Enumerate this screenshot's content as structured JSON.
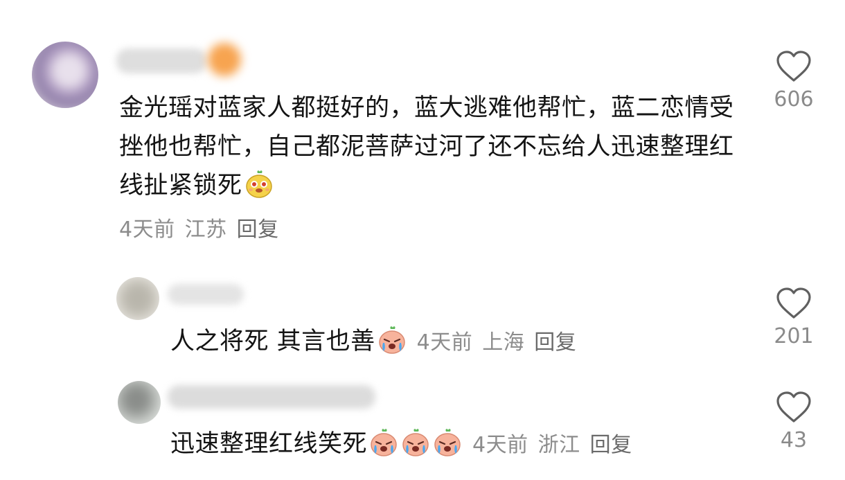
{
  "comments": [
    {
      "text": "金光瑶对蓝家人都挺好的，蓝大逃难他帮忙，蓝二恋情受挫他也帮忙，自己都泥菩萨过河了还不忘给人迅速整理红线扯紧锁死",
      "emoji": "smiling-face-emoji",
      "time": "4天前",
      "location": "江苏",
      "reply_label": "回复",
      "likes": "606"
    },
    {
      "text": "人之将死 其言也善",
      "emoji": "crying-face-emoji",
      "time": "4天前",
      "location": "上海",
      "reply_label": "回复",
      "likes": "201"
    },
    {
      "text": "迅速整理红线笑死",
      "emoji": "crying-face-emoji",
      "emoji_count": 3,
      "time": "4天前",
      "location": "浙江",
      "reply_label": "回复",
      "likes": "43"
    }
  ]
}
